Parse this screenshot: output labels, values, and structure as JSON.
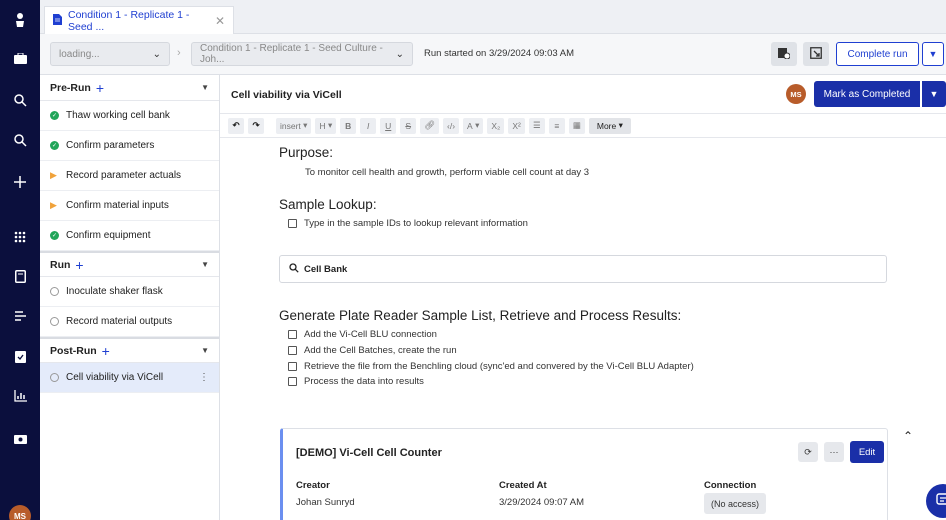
{
  "tab": {
    "label": "Condition 1 - Replicate 1 - Seed ..."
  },
  "toolbar": {
    "loading_select": "loading...",
    "entry_select": "Condition 1 - Replicate 1 - Seed Culture - Joh...",
    "run_started": "Run started on 3/29/2024 09:03 AM",
    "complete_run": "Complete run"
  },
  "sidebar": {
    "sections": [
      {
        "title": "Pre-Run",
        "items": [
          {
            "label": "Thaw working cell bank",
            "status": "done"
          },
          {
            "label": "Confirm parameters",
            "status": "done"
          },
          {
            "label": "Record parameter actuals",
            "status": "in-progress"
          },
          {
            "label": "Confirm material inputs",
            "status": "in-progress"
          },
          {
            "label": "Confirm equipment",
            "status": "done"
          }
        ]
      },
      {
        "title": "Run",
        "items": [
          {
            "label": "Inoculate shaker flask",
            "status": "empty"
          },
          {
            "label": "Record material outputs",
            "status": "empty"
          }
        ]
      },
      {
        "title": "Post-Run",
        "items": [
          {
            "label": "Cell viability via ViCell",
            "status": "empty"
          }
        ]
      }
    ]
  },
  "main": {
    "title": "Cell viability via ViCell",
    "avatar": "MS",
    "mark_completed": "Mark as Completed"
  },
  "editor": {
    "insert": "insert",
    "heading": "H",
    "bold": "B",
    "italic": "I",
    "underline": "U",
    "strike": "S",
    "font_color": "A",
    "subscript": "X₂",
    "superscript": "X²",
    "more": "More"
  },
  "content": {
    "purpose_heading": "Purpose:",
    "purpose_text": "To monitor cell health and growth, perform viable cell count at day 3",
    "lookup_heading": "Sample Lookup:",
    "lookup_item": "Type in the sample IDs to lookup relevant information",
    "search_label": "Cell Bank",
    "generate_heading": "Generate Plate Reader Sample List, Retrieve and Process Results:",
    "checklist": [
      "Add the Vi-Cell BLU connection",
      "Add the Cell Batches, create the run",
      "Retrieve the file from the Benchling cloud (sync'ed and convered by the Vi-Cell BLU Adapter)",
      "Process the data into results"
    ]
  },
  "card": {
    "title": "[DEMO] Vi-Cell Cell Counter",
    "edit": "Edit",
    "creator_label": "Creator",
    "creator_value": "Johan Sunryd",
    "created_label": "Created At",
    "created_value": "3/29/2024 09:07 AM",
    "connection_label": "Connection",
    "connection_value": "(No access)"
  },
  "rail": {
    "avatar": "MS"
  },
  "colors": {
    "rail": "#0b0f3d",
    "primary": "#1a2fa8",
    "link": "#1f3fd1",
    "done": "#22a65a",
    "progress": "#f0a23a"
  }
}
